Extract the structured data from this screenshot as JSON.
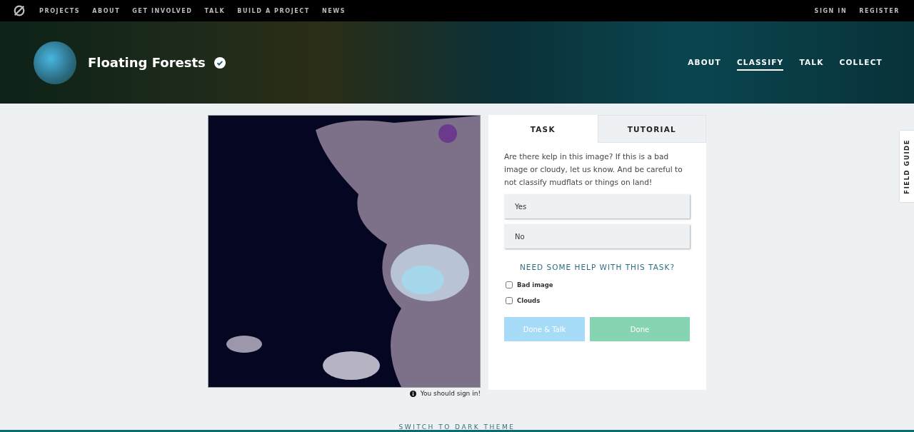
{
  "top_nav": {
    "links": [
      {
        "label": "PROJECTS"
      },
      {
        "label": "ABOUT"
      },
      {
        "label": "GET INVOLVED"
      },
      {
        "label": "TALK"
      },
      {
        "label": "BUILD A PROJECT"
      },
      {
        "label": "NEWS"
      }
    ],
    "account": [
      {
        "label": "SIGN IN"
      },
      {
        "label": "REGISTER"
      }
    ]
  },
  "project": {
    "title": "Floating Forests",
    "verified": true,
    "nav": [
      {
        "label": "ABOUT",
        "selected": false
      },
      {
        "label": "CLASSIFY",
        "selected": true
      },
      {
        "label": "TALK",
        "selected": false
      },
      {
        "label": "COLLECT",
        "selected": false
      }
    ]
  },
  "tabs": [
    {
      "label": "TASK",
      "selected": true
    },
    {
      "label": "TUTORIAL",
      "selected": false
    }
  ],
  "task": {
    "question": "Are there kelp in this image? If this is a bad image or cloudy, let us know. And be careful to not classify mudflats or things on land!",
    "answers": [
      {
        "label": "Yes",
        "selected": false
      },
      {
        "label": "No",
        "selected": false
      }
    ],
    "help_link": "NEED SOME HELP WITH THIS TASK?",
    "flags": [
      {
        "label": "Bad image",
        "checked": false
      },
      {
        "label": "Clouds",
        "checked": false
      }
    ],
    "buttons": [
      {
        "label": "Done & Talk",
        "kind": "talk",
        "disabled": true
      },
      {
        "label": "Done",
        "kind": "done",
        "disabled": true
      }
    ]
  },
  "sign_in_note": "You should sign in!",
  "field_guide": "FIELD GUIDE",
  "theme_toggle": "SWITCH TO DARK THEME"
}
